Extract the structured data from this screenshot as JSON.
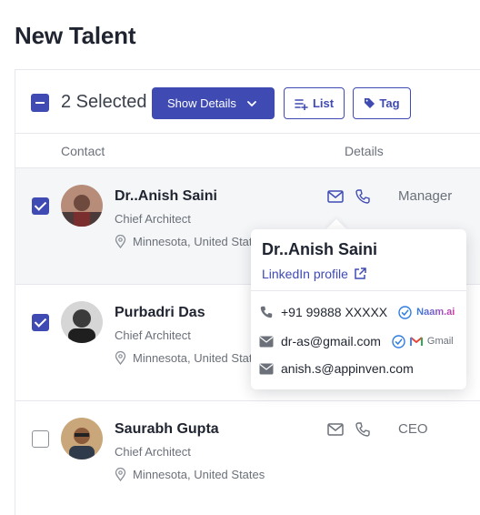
{
  "page": {
    "title": "New Talent"
  },
  "toolbar": {
    "selected_text": "2 Selected",
    "show_details_label": "Show Details",
    "list_label": "List",
    "tag_label": "Tag"
  },
  "columns": {
    "contact": "Contact",
    "details": "Details"
  },
  "colors": {
    "primary": "#3f4bb3",
    "verified": "#2f7de1"
  },
  "rows": [
    {
      "name": "Dr..Anish Saini",
      "title": "Chief Architect",
      "location": "Minnesota, United States",
      "role": "Manager",
      "checked": true
    },
    {
      "name": "Purbadri Das",
      "title": "Chief Architect",
      "location": "Minnesota, United States",
      "role": "",
      "checked": true
    },
    {
      "name": "Saurabh Gupta",
      "title": "Chief Architect",
      "location": "Minnesota, United States",
      "role": "CEO",
      "checked": false
    }
  ],
  "popover": {
    "name": "Dr..Anish Saini",
    "linkedin_label": "LinkedIn profile",
    "phone": "+91 99888 XXXXX",
    "phone_source": "Naam.ai",
    "email_1": "dr-as@gmail.com",
    "email_1_source": "Gmail",
    "email_2": "anish.s@appinven.com"
  }
}
